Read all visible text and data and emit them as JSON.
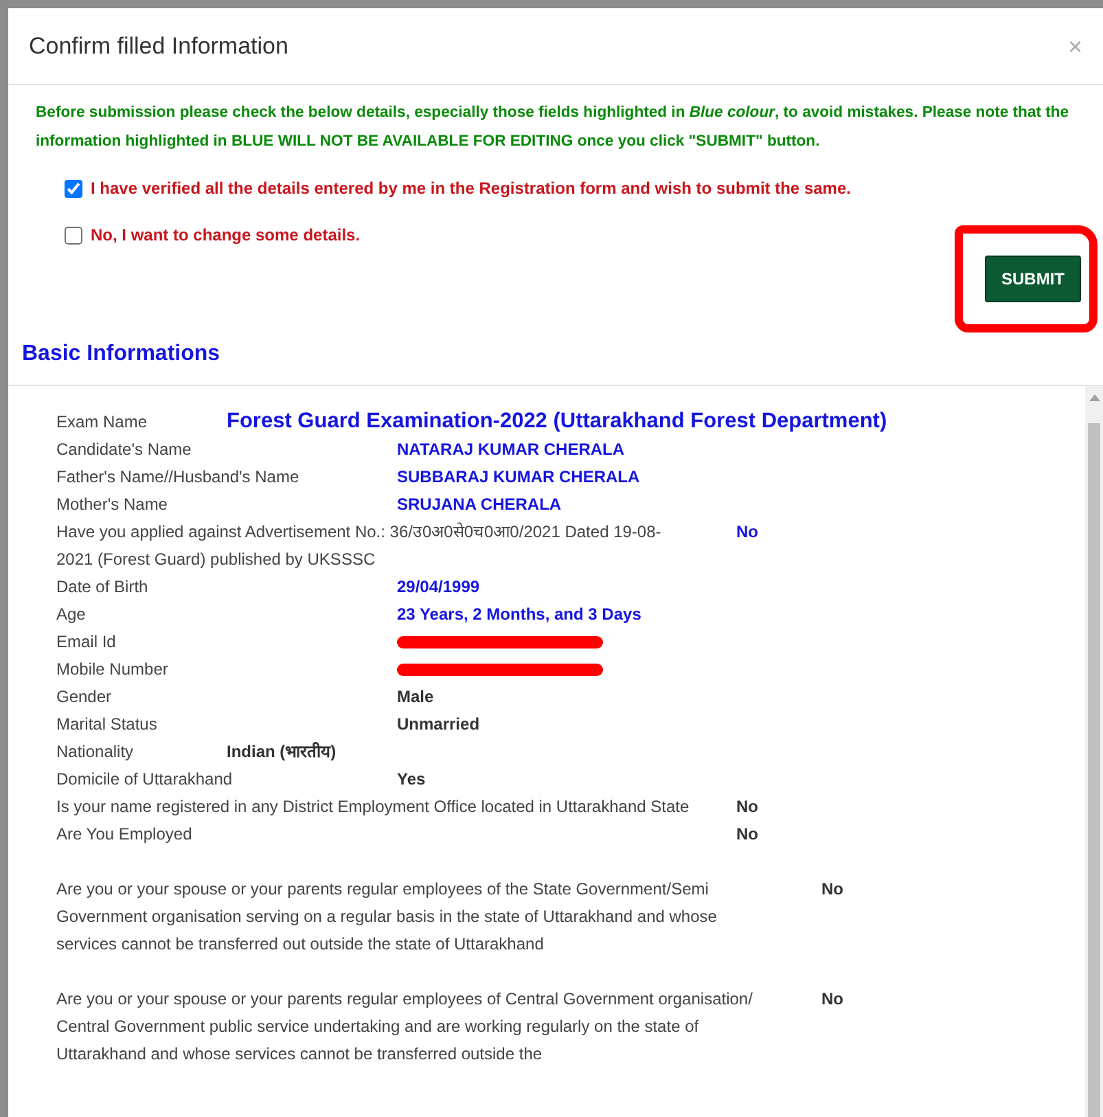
{
  "modal": {
    "title": "Confirm filled Information",
    "close": "×"
  },
  "notice": "Before submission please check the below details, especially those fields highlighted in *Blue colour*, to avoid mistakes. Please note that the information highlighted in BLUE WILL NOT BE AVAILABLE FOR EDITING once you click \"SUBMIT\" button.",
  "options": [
    {
      "label": "I have verified all the details entered by me in the Registration form and wish to submit the same.",
      "checked": true
    },
    {
      "label": "No, I want to change some details.",
      "checked": false
    }
  ],
  "submit": {
    "label": "SUBMIT",
    "circled": true
  },
  "section_title": "Basic Informations",
  "rows": [
    {
      "kind": "title",
      "label": "Exam Name",
      "value": "Forest Guard Examination-2022 (Uttarakhand Forest Department)",
      "highlighted": true
    },
    {
      "kind": "normal",
      "label": "Candidate's Name",
      "value": "NATARAJ KUMAR CHERALA",
      "highlighted": true
    },
    {
      "kind": "normal",
      "label": "Father's Name//Husband's Name",
      "value": "SUBBARAJ KUMAR CHERALA",
      "highlighted": true
    },
    {
      "kind": "normal",
      "label": "Mother's Name",
      "value": "SRUJANA CHERALA",
      "highlighted": true
    },
    {
      "kind": "wide",
      "label": "Have you applied against Advertisement No.: 36/उ0अ0से0च0आ0/2021 Dated 19-08-2021 (Forest Guard) published by UKSSSC",
      "value": "No",
      "highlighted": true
    },
    {
      "kind": "normal",
      "label": "Date of Birth",
      "value": "29/04/1999",
      "highlighted": true
    },
    {
      "kind": "normal",
      "label": "Age",
      "value": "23 Years, 2 Months, and 3 Days",
      "highlighted": true
    },
    {
      "kind": "normal",
      "label": "Email Id",
      "redacted": true
    },
    {
      "kind": "normal",
      "label": "Mobile Number",
      "redacted": true
    },
    {
      "kind": "normal",
      "label": "Gender",
      "value": "Male",
      "highlighted": false
    },
    {
      "kind": "normal",
      "label": "Marital Status",
      "value": "Unmarried",
      "highlighted": false
    },
    {
      "kind": "short",
      "label": "Nationality",
      "value": "Indian (भारतीय)",
      "highlighted": false
    },
    {
      "kind": "normal",
      "label": "Domicile of Uttarakhand",
      "value": "Yes",
      "highlighted": false
    },
    {
      "kind": "wide",
      "label": "Is your name registered in any District Employment Office located in Uttarakhand State",
      "value": "No",
      "highlighted": false
    },
    {
      "kind": "wide",
      "label": "Are You Employed",
      "value": "No",
      "highlighted": false
    },
    {
      "kind": "extra",
      "label": "Are you or your spouse or your parents regular employees of the State Government/Semi Government organisation serving on a regular basis in the state of Uttarakhand and whose services cannot be transferred out outside the state of Uttarakhand",
      "value": "No",
      "highlighted": false
    },
    {
      "kind": "extra",
      "label": "Are you or your spouse or your parents regular employees of Central Government organisation/ Central Government public service undertaking and are working regularly on the state of Uttarakhand and whose services cannot be transferred outside the",
      "value": "No",
      "highlighted": false
    }
  ]
}
